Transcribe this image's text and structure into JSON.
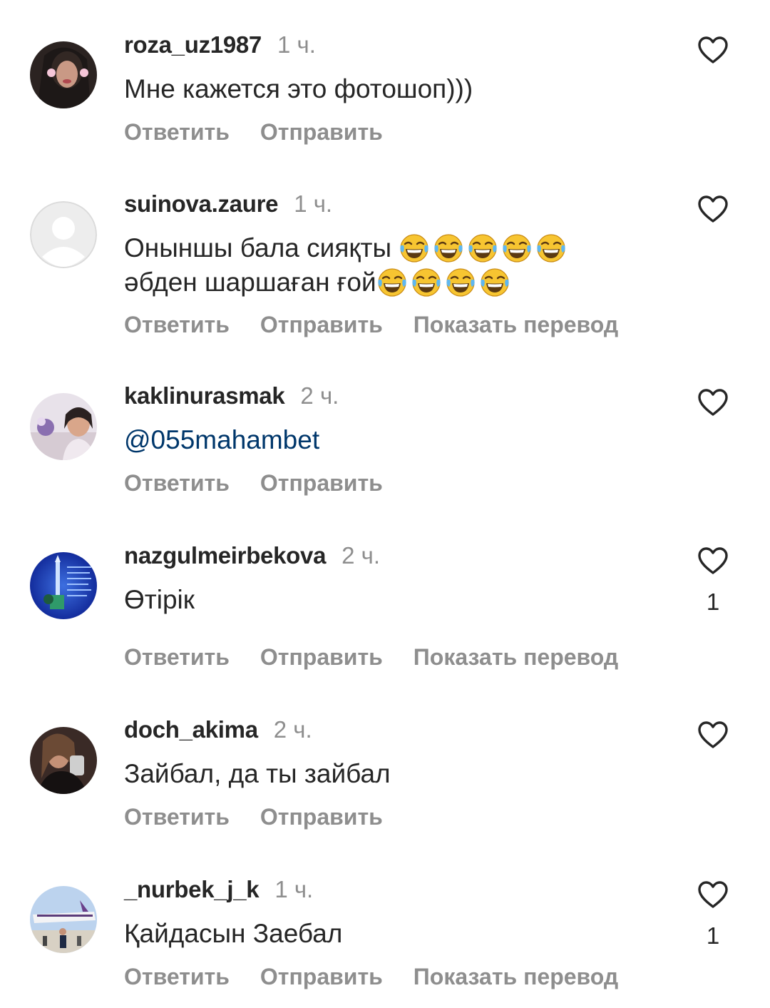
{
  "comments": [
    {
      "username": "roza_uz1987",
      "time": "1 ч.",
      "text_line1": "Мне  кажется это фотошоп)))",
      "reply_label": "Ответить",
      "send_label": "Отправить"
    },
    {
      "username": "suinova.zaure",
      "time": "1 ч.",
      "text_line1": "Онынш­ы бала сияқты",
      "text_line2": "әбден шаршаған ғой",
      "emoji_name": "face-with-tears-of-joy-emoji",
      "reply_label": "Ответить",
      "send_label": "Отправить",
      "translate_label": "Показать перевод"
    },
    {
      "username": "kaklinurasmak",
      "time": "2 ч.",
      "text_line1": "@055mahambet",
      "reply_label": "Ответить",
      "send_label": "Отправить"
    },
    {
      "username": "nazgulmeirbekova",
      "time": "2 ч.",
      "text_line1": "Өтірік",
      "likes": "1",
      "reply_label": "Ответить",
      "send_label": "Отправить",
      "translate_label": "Показать перевод"
    },
    {
      "username": "doch_akima",
      "time": "2 ч.",
      "text_line1": "Зайбал, да ты зайбал",
      "reply_label": "Ответить",
      "send_label": "Отправить"
    },
    {
      "username": "_nurbek_j_k",
      "time": "1 ч.",
      "text_line1": "Қайдасын Заебал",
      "likes": "1",
      "reply_label": "Ответить",
      "send_label": "Отправить",
      "translate_label": "Показать перевод"
    }
  ],
  "icons": {
    "like": "heart-outline-icon"
  },
  "colors": {
    "text": "#262626",
    "secondary": "#8e8e8e",
    "mention": "#00376b",
    "emoji": "#f7c531"
  }
}
